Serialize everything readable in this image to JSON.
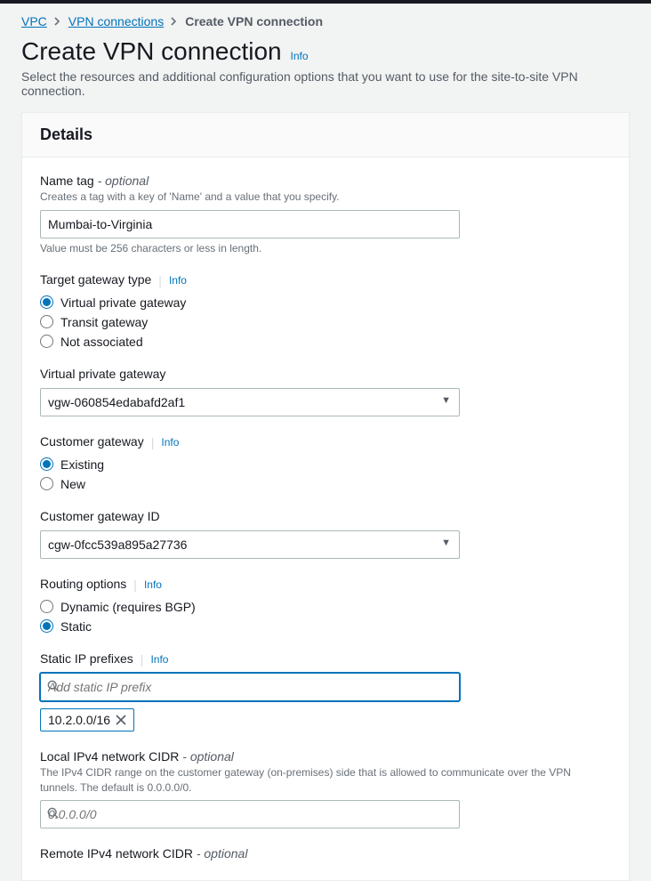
{
  "breadcrumb": {
    "root": "VPC",
    "mid": "VPN connections",
    "current": "Create VPN connection"
  },
  "page": {
    "title": "Create VPN connection",
    "info": "Info",
    "subtitle": "Select the resources and additional configuration options that you want to use for the site-to-site VPN connection."
  },
  "details": {
    "heading": "Details",
    "name_tag": {
      "label": "Name tag",
      "optional": " - optional",
      "desc": "Creates a tag with a key of 'Name' and a value that you specify.",
      "value": "Mumbai-to-Virginia",
      "hint": "Value must be 256 characters or less in length."
    },
    "target_gateway_type": {
      "label": "Target gateway type",
      "info": "Info",
      "options": {
        "vpg": "Virtual private gateway",
        "tgw": "Transit gateway",
        "na": "Not associated"
      }
    },
    "vpg": {
      "label": "Virtual private gateway",
      "value": "vgw-060854edabafd2af1"
    },
    "customer_gateway": {
      "label": "Customer gateway",
      "info": "Info",
      "options": {
        "existing": "Existing",
        "new": "New"
      }
    },
    "cgw_id": {
      "label": "Customer gateway ID",
      "value": "cgw-0fcc539a895a27736"
    },
    "routing": {
      "label": "Routing options",
      "info": "Info",
      "options": {
        "dynamic": "Dynamic (requires BGP)",
        "static": "Static"
      }
    },
    "static_ip": {
      "label": "Static IP prefixes",
      "info": "Info",
      "placeholder": "Add static IP prefix",
      "chip": "10.2.0.0/16"
    },
    "local_ipv4": {
      "label": "Local IPv4 network CIDR",
      "optional": " - optional",
      "desc": "The IPv4 CIDR range on the customer gateway (on-premises) side that is allowed to communicate over the VPN tunnels. The default is 0.0.0.0/0.",
      "placeholder": "0.0.0.0/0"
    },
    "remote_ipv4": {
      "label": "Remote IPv4 network CIDR",
      "optional": " - optional"
    }
  }
}
